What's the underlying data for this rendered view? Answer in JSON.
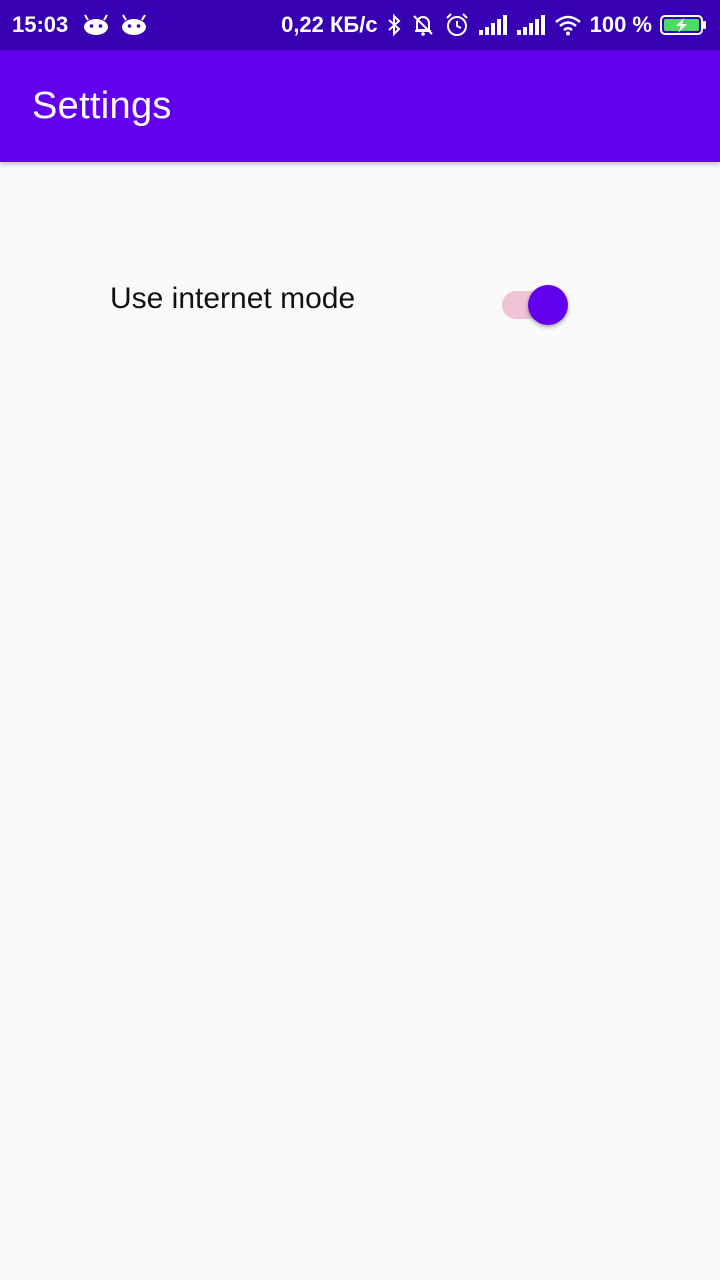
{
  "status_bar": {
    "time": "15:03",
    "network_speed": "0,22 КБ/с",
    "battery": "100 %",
    "notification_icons": [
      "android-icon",
      "android-icon"
    ],
    "system_icons": [
      "bluetooth-icon",
      "mute-icon",
      "alarm-icon",
      "signal-icon",
      "signal-icon",
      "wifi-icon",
      "battery-charging-icon"
    ]
  },
  "app_bar": {
    "title": "Settings"
  },
  "settings": {
    "internet_mode": {
      "label": "Use internet mode",
      "enabled": true
    }
  },
  "colors": {
    "status_bar": "#3700b3",
    "primary": "#6200ee",
    "switch_track_on": "#efc3d5",
    "background": "#fafafa"
  }
}
